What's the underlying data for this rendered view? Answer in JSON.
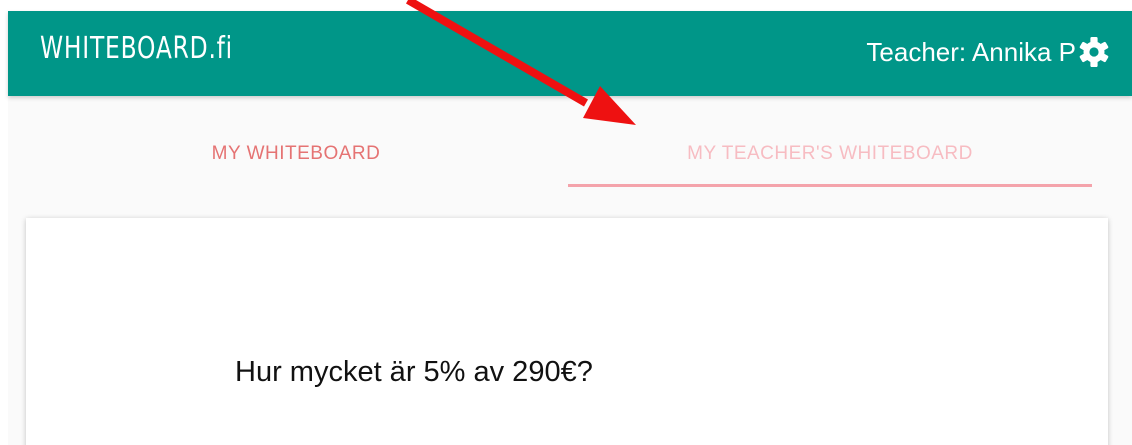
{
  "header": {
    "logo_text": "WHITEBOARD.fi",
    "user_label": "Teacher: Annika P",
    "settings_icon": "gear-icon",
    "bar_color": "#009688"
  },
  "tabs": [
    {
      "label": "MY WHITEBOARD",
      "active": false,
      "color": "#e57373"
    },
    {
      "label": "MY TEACHER'S WHITEBOARD",
      "active": true,
      "color": "#f7bcc2"
    }
  ],
  "board": {
    "text": "Hur mycket är 5% av 290€?"
  },
  "annotation": {
    "arrow_color": "#ee1111",
    "arrow_target": "tab-teachers-whiteboard"
  }
}
